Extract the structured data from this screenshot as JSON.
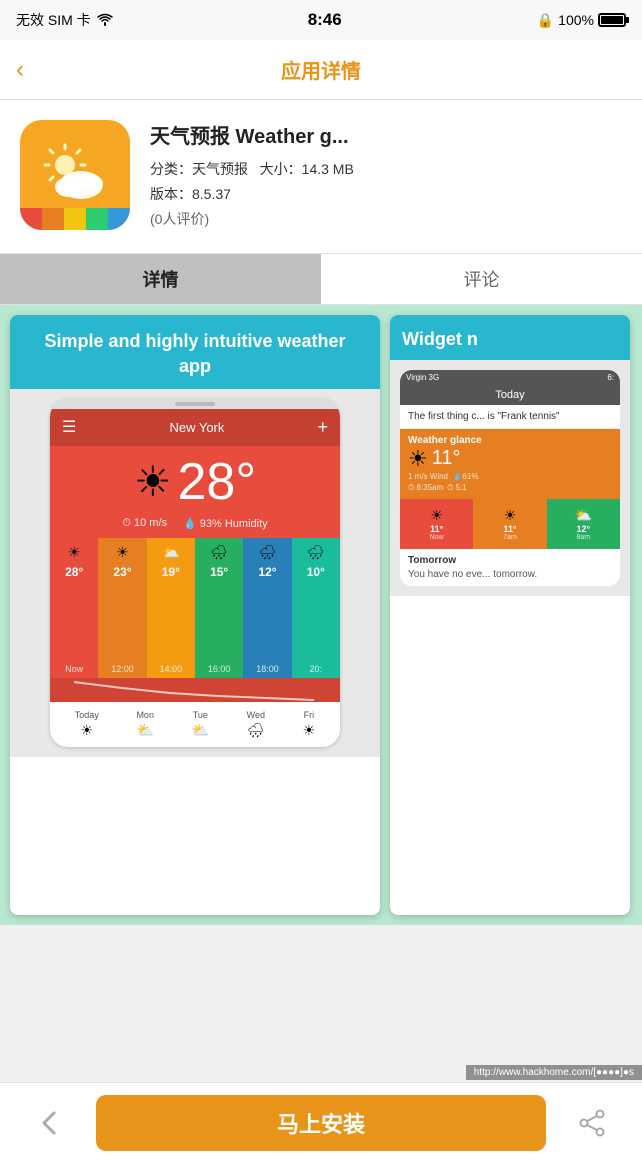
{
  "statusBar": {
    "carrier": "无效 SIM 卡",
    "wifi": "WiFi",
    "time": "8:46",
    "lock": "🔒",
    "battery": "100%"
  },
  "navBar": {
    "backLabel": "‹",
    "title": "应用详情"
  },
  "appInfo": {
    "name": "天气预报 Weather g...",
    "category": "天气预报",
    "categoryLabel": "分类：",
    "size": "14.3 MB",
    "sizeLabel": "大小：",
    "version": "8.5.37",
    "versionLabel": "版本：",
    "ratings": "(0人评价)"
  },
  "tabs": {
    "details": "详情",
    "reviews": "评论"
  },
  "screenshot1": {
    "header": "Simple and highly intuitive weather app",
    "cityName": "New York",
    "temperature": "28°",
    "windSpeed": "10 m/s",
    "humidity": "93% Humidity",
    "forecastBars": [
      {
        "temp": "28°",
        "time": "Now",
        "icon": "☀"
      },
      {
        "temp": "23°",
        "time": "12:00",
        "icon": "☀"
      },
      {
        "temp": "19°",
        "time": "14:00",
        "icon": "⛅"
      },
      {
        "temp": "15°",
        "time": "16:00",
        "icon": "🌧"
      },
      {
        "temp": "12°",
        "time": "18:00",
        "icon": "🌧"
      },
      {
        "temp": "10°",
        "time": "20:",
        "icon": "🌧"
      }
    ],
    "weeklyDays": [
      "Today",
      "Mon",
      "Tue",
      "Wed",
      "Fri"
    ],
    "weeklyIcons": [
      "☀",
      "⛅",
      "⛅",
      "🌧",
      "☀"
    ]
  },
  "screenshot2": {
    "header": "Widget n",
    "widgetTitle": "Today",
    "notificationText": "The first thing c... is \"Frank tennis\"",
    "weatherGlanceLabel": "Weather glance",
    "temperature": "11°",
    "windInfo": "1 m/s Wind",
    "humidity": "61%",
    "times": [
      "6:35am",
      "5:1"
    ],
    "tempBars": [
      {
        "temp": "11°",
        "label": "Now"
      },
      {
        "temp": "11°",
        "label": "7am"
      },
      {
        "temp": "12°",
        "label": "8am"
      }
    ],
    "tomorrowTitle": "Tomorrow",
    "tomorrowText": "You have no eve... tomorrow."
  },
  "bottomBar": {
    "installLabel": "马上安装",
    "footerUrl": "http://www.hackhome.com/[●●●●]●s"
  }
}
